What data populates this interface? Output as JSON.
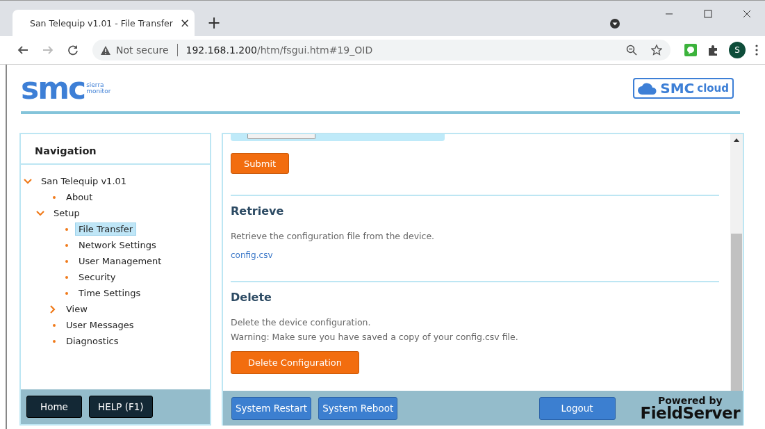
{
  "browser": {
    "tab": {
      "title": "San Telequip v1.01 - File Transfer",
      "close": "×"
    },
    "new_tab": "+",
    "security": "Not secure",
    "url_host": "192.168.1.200",
    "url_path": "/htm/fsgui.htm#19_OID",
    "profile": "S"
  },
  "header": {
    "logo": "smc",
    "logo_sub": [
      "sierra",
      "monitor"
    ],
    "cloud_logo": "SMC",
    "cloud_word": "cloud"
  },
  "navigation": {
    "title": "Navigation",
    "items": [
      {
        "label": "San Telequip v1.01",
        "expanded": true,
        "selected": false,
        "children": [
          {
            "label": "About",
            "selected": false
          },
          {
            "label": "Setup",
            "expanded": true,
            "selected": false,
            "children": [
              {
                "label": "File Transfer",
                "selected": true
              },
              {
                "label": "Network Settings",
                "selected": false
              },
              {
                "label": "User Management",
                "selected": false
              },
              {
                "label": "Security",
                "selected": false
              },
              {
                "label": "Time Settings",
                "selected": false
              }
            ]
          },
          {
            "label": "View",
            "expanded": false,
            "selected": false
          },
          {
            "label": "User Messages",
            "selected": false
          },
          {
            "label": "Diagnostics",
            "selected": false
          }
        ]
      }
    ],
    "buttons": [
      "Home",
      "HELP (F1)"
    ]
  },
  "content": {
    "submit": "Submit",
    "sections": [
      {
        "title": "Retrieve",
        "lines": [
          "Retrieve the configuration file from the device."
        ],
        "link": "config.csv"
      },
      {
        "title": "Delete",
        "lines": [
          "Delete the device configuration.",
          "Warning: Make sure you have saved a copy of your config.csv file."
        ],
        "button": "Delete Configuration"
      }
    ],
    "buttons": [
      "System Restart",
      "System Reboot"
    ],
    "logout": "Logout",
    "powered_by": "Powered by",
    "brand": "FieldServer"
  }
}
